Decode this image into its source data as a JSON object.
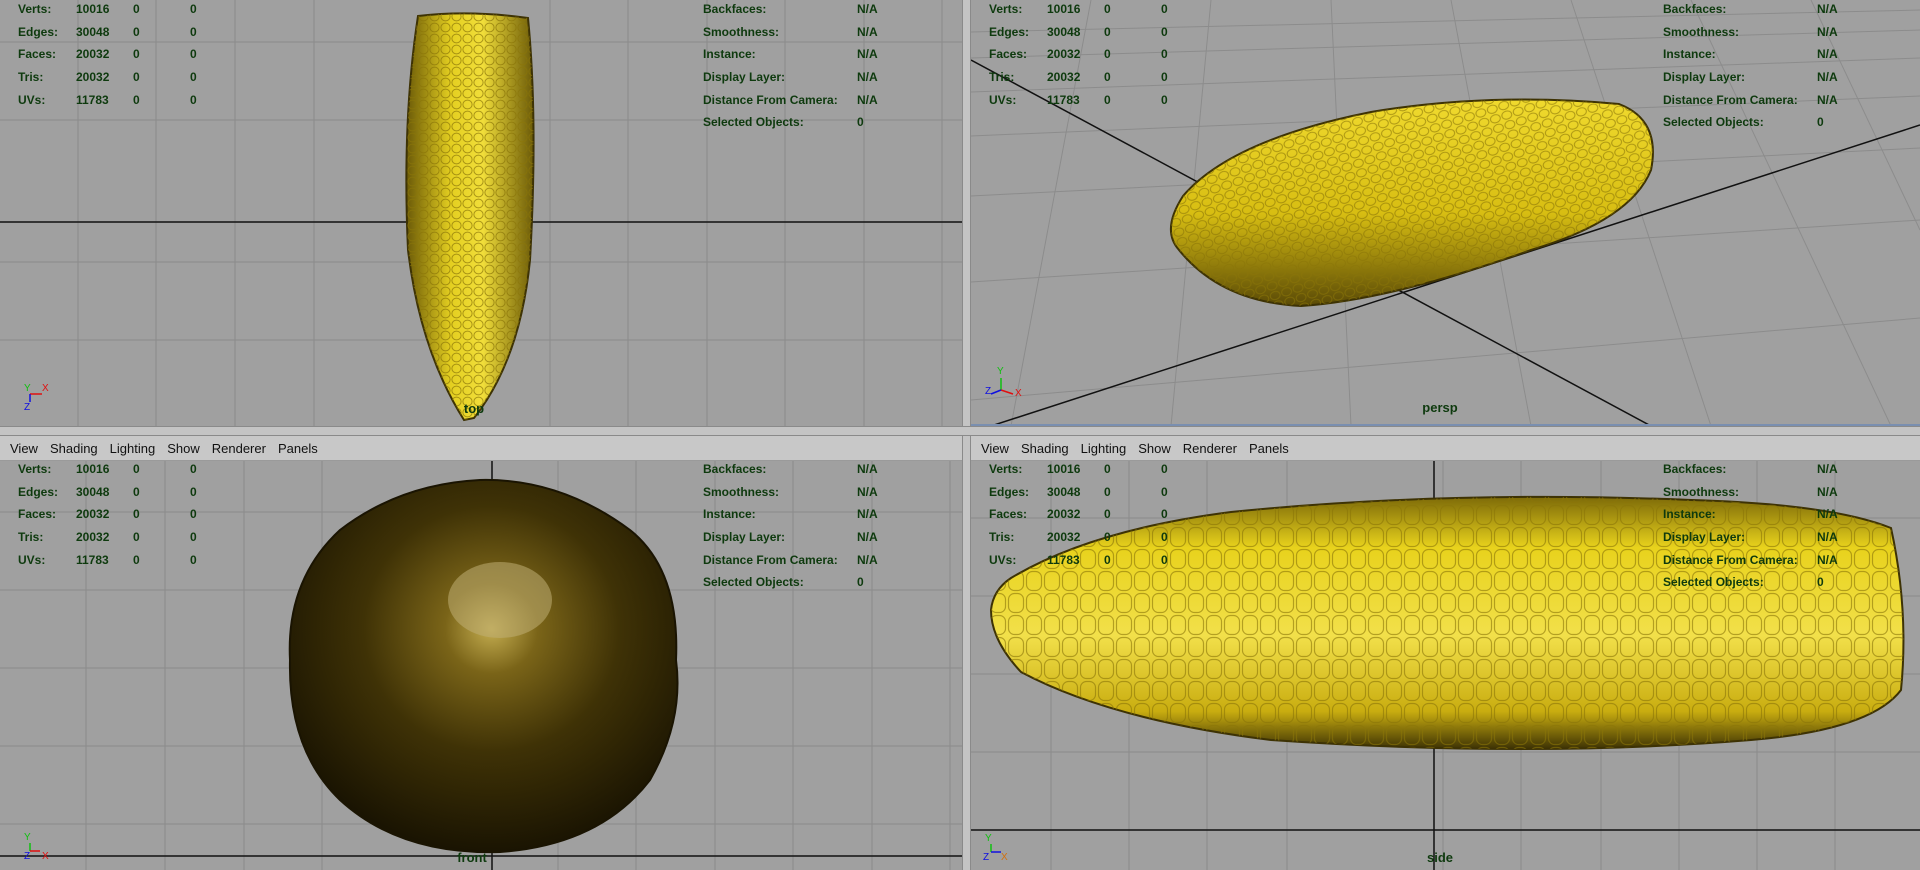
{
  "menus": [
    "View",
    "Shading",
    "Lighting",
    "Show",
    "Renderer",
    "Panels"
  ],
  "hud_stats": [
    {
      "label": "Verts:",
      "v1": "10016",
      "v2": "0",
      "v3": "0"
    },
    {
      "label": "Edges:",
      "v1": "30048",
      "v2": "0",
      "v3": "0"
    },
    {
      "label": "Faces:",
      "v1": "20032",
      "v2": "0",
      "v3": "0"
    },
    {
      "label": "Tris:",
      "v1": "20032",
      "v2": "0",
      "v3": "0"
    },
    {
      "label": "UVs:",
      "v1": "11783",
      "v2": "0",
      "v3": "0"
    }
  ],
  "hud_info": [
    {
      "label": "Backfaces:",
      "value": "N/A"
    },
    {
      "label": "Smoothness:",
      "value": "N/A"
    },
    {
      "label": "Instance:",
      "value": "N/A"
    },
    {
      "label": "Display Layer:",
      "value": "N/A"
    },
    {
      "label": "Distance From Camera:",
      "value": "N/A"
    },
    {
      "label": "Selected Objects:",
      "value": "0"
    }
  ],
  "panels": {
    "top": {
      "camera": "top"
    },
    "persp": {
      "camera": "persp"
    },
    "front": {
      "camera": "front"
    },
    "side": {
      "camera": "side"
    }
  },
  "colors": {
    "viewport_bg": "#a0a0a0",
    "hud_text": "#0e3a0e",
    "corn_yellow": "#e6cf1a",
    "corn_dark": "#4a3a05",
    "axis_x": "#e01010",
    "axis_y": "#10c010",
    "axis_z": "#1010e0"
  }
}
